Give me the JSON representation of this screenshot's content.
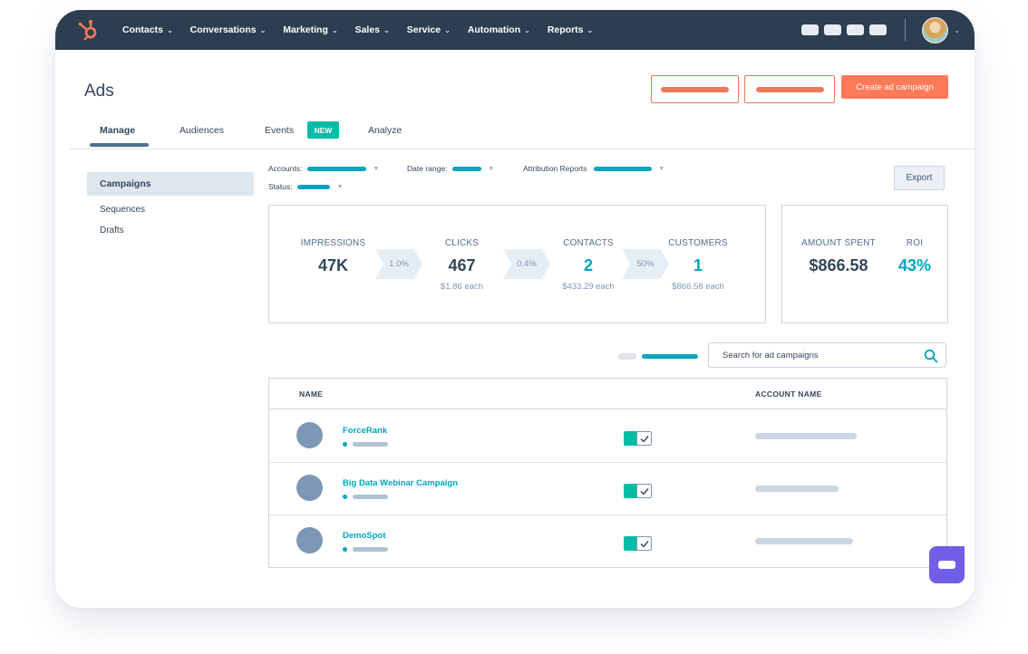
{
  "nav": {
    "items": [
      {
        "label": "Contacts"
      },
      {
        "label": "Conversations"
      },
      {
        "label": "Marketing"
      },
      {
        "label": "Sales"
      },
      {
        "label": "Service"
      },
      {
        "label": "Automation"
      },
      {
        "label": "Reports"
      }
    ],
    "chevron": "⌄",
    "logo_icon": "hubspot-sprocket-icon"
  },
  "page": {
    "title": "Ads"
  },
  "actions": {
    "create_campaign": "Create ad campaign"
  },
  "tabs": [
    {
      "label": "Manage",
      "active": true
    },
    {
      "label": "Audiences"
    },
    {
      "label": "Events"
    },
    {
      "label": "Analyze"
    }
  ],
  "badge_new": "NEW",
  "sidebar": {
    "items": [
      {
        "label": "Campaigns",
        "active": true
      },
      {
        "label": "Sequences"
      },
      {
        "label": "Drafts"
      }
    ]
  },
  "filters": {
    "accounts": "Accounts:",
    "date_range": "Date range:",
    "attribution": "Attribution Reports",
    "status": "Status:"
  },
  "export_label": "Export",
  "funnel": {
    "impressions": {
      "label": "IMPRESSIONS",
      "value": "47K"
    },
    "rate1": "1.0%",
    "clicks": {
      "label": "CLICKS",
      "value": "467",
      "sub": "$1.86 each"
    },
    "rate2": "0.4%",
    "contacts": {
      "label": "CONTACTS",
      "value": "2",
      "sub": "$433.29 each"
    },
    "rate3": "50%",
    "customers": {
      "label": "CUSTOMERS",
      "value": "1",
      "sub": "$866.58 each"
    }
  },
  "spend": {
    "amount": {
      "label": "AMOUNT SPENT",
      "value": "$866.58"
    },
    "roi": {
      "label": "ROI",
      "value": "43%"
    }
  },
  "search": {
    "placeholder": "Search for ad campaigns"
  },
  "table": {
    "headers": {
      "name": "NAME",
      "account": "ACCOUNT NAME"
    },
    "rows": [
      {
        "name": "ForceRank",
        "enabled": true
      },
      {
        "name": "Big Data Webinar Campaign",
        "enabled": true
      },
      {
        "name": "DemoSpot",
        "enabled": true
      }
    ]
  },
  "colors": {
    "nav_bg": "#2d3e50",
    "accent_orange": "#ff7a59",
    "accent_teal": "#00a4bd",
    "chat_purple": "#6f5fe6"
  }
}
